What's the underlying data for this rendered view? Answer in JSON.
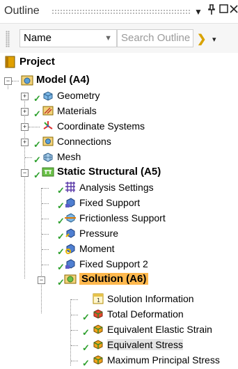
{
  "panel": {
    "title": "Outline",
    "pin_glyph": "▾",
    "pin_icon": "pin-icon",
    "maximize_icon": "maximize-icon",
    "close_icon": "close-icon"
  },
  "toolbar": {
    "name_select": "Name",
    "search_placeholder": "Search Outline"
  },
  "tree": {
    "project": "Project",
    "model": "Model (A4)",
    "geometry": "Geometry",
    "materials": "Materials",
    "coordinate_systems": "Coordinate Systems",
    "connections": "Connections",
    "mesh": "Mesh",
    "static_structural": "Static Structural (A5)",
    "analysis_settings": "Analysis Settings",
    "fixed_support": "Fixed Support",
    "frictionless_support": "Frictionless Support",
    "pressure": "Pressure",
    "moment": "Moment",
    "fixed_support_2": "Fixed Support 2",
    "solution": "Solution (A6)",
    "solution_information": "Solution Information",
    "total_deformation": "Total Deformation",
    "equivalent_elastic_strain": "Equivalent Elastic Strain",
    "equivalent_stress": "Equivalent Stress",
    "maximum_principal_stress": "Maximum Principal Stress"
  },
  "colors": {
    "selected_bg": "#ffb84d",
    "check_green": "#2da02d",
    "accent_yellow": "#d9a300"
  }
}
